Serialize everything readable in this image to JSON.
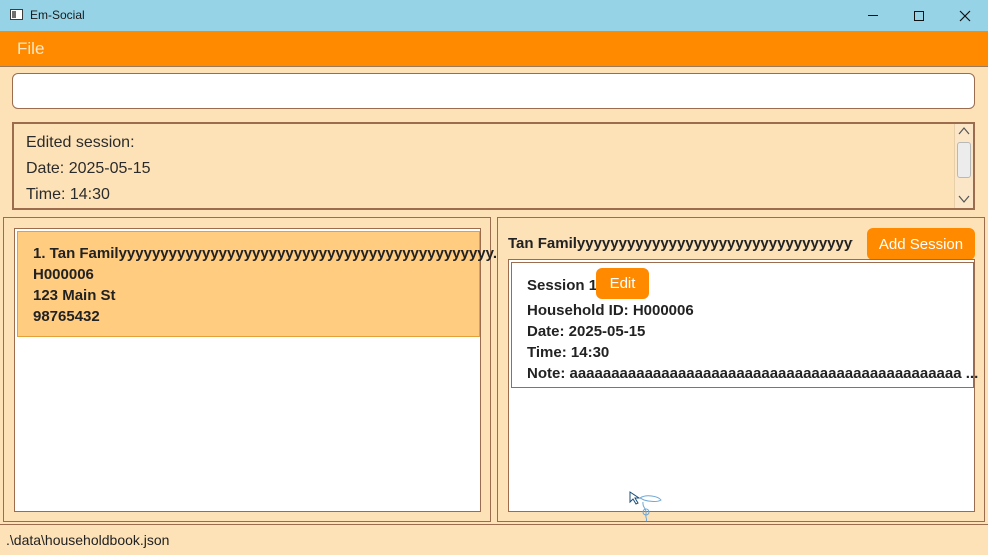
{
  "window": {
    "title": "Em-Social",
    "controls": [
      "minimize",
      "maximize",
      "close"
    ]
  },
  "menu": {
    "file_label": "File"
  },
  "command_box": {
    "value": ""
  },
  "result_display": {
    "lines": [
      "Edited session:",
      "Date: 2025-05-15",
      "Time: 14:30"
    ]
  },
  "household_list": {
    "items": [
      {
        "index_name": "1.  Tan Familyyyyyyyyyyyyyyyyyyyyyyyyyyyyyyyyyyyyyyyyyyyyy...",
        "id": "H000006",
        "address": "123 Main St",
        "phone": "98765432"
      }
    ]
  },
  "session_panel": {
    "household_name": "Tan Familyyyyyyyyyyyyyyyyyyyyyyyyyyyyyyyyyyyyy...",
    "add_session_label": "Add Session",
    "sessions": [
      {
        "title": "Session 1",
        "edit_label": "Edit",
        "household_id": "Household ID: H000006",
        "date": "Date: 2025-05-15",
        "time": "Time: 14:30",
        "note": "Note: aaaaaaaaaaaaaaaaaaaaaaaaaaaaaaaaaaaaaaaaaaaaaaa ..."
      }
    ]
  },
  "status_bar": {
    "path": ".\\data\\householdbook.json"
  },
  "colors": {
    "titlebar": "#96d3e7",
    "menubar": "#ff8a00",
    "panel_bg": "#fde2b8",
    "selected_card": "#ffcc80",
    "button": "#ff8a00"
  }
}
